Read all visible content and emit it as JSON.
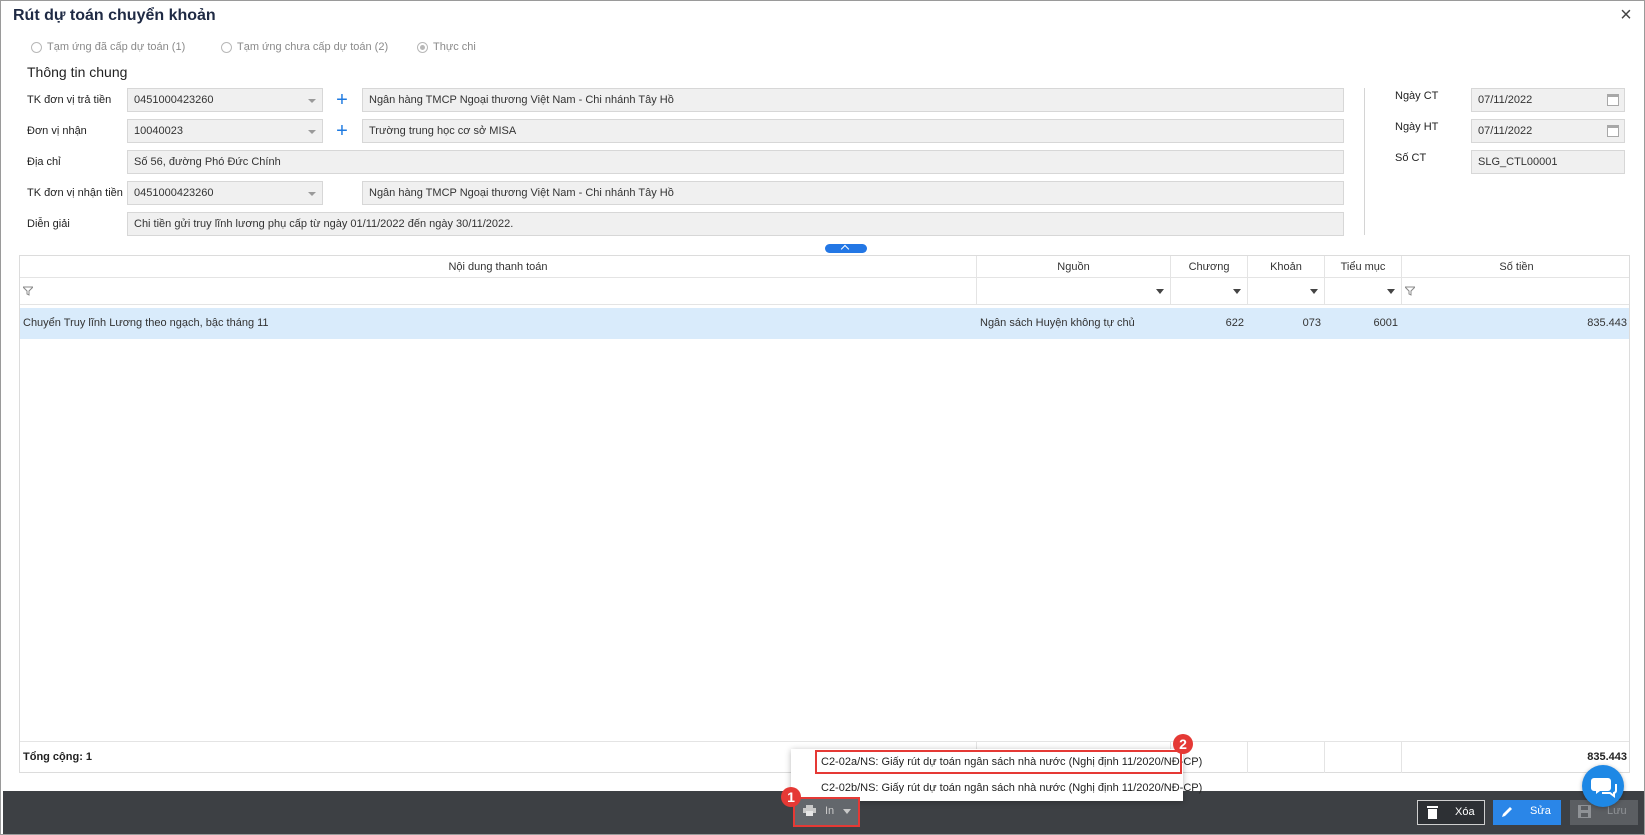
{
  "window": {
    "title": "Rút dự toán chuyển khoản",
    "close_icon": "close-icon"
  },
  "payment_types": [
    {
      "label": "Tạm ứng đã cấp dự toán (1)",
      "selected": false
    },
    {
      "label": "Tạm ứng chưa cấp dự toán (2)",
      "selected": false
    },
    {
      "label": "Thực chi",
      "selected": true
    }
  ],
  "general": {
    "title": "Thông tin chung",
    "payer_account": {
      "label": "TK đơn vị trả tiền",
      "value": "0451000423260",
      "bank": "Ngân hàng TMCP Ngoại thương Việt Nam - Chi nhánh Tây Hồ"
    },
    "receiver": {
      "label": "Đơn vị nhận",
      "value": "10040023",
      "name": "Trường trung học cơ sở MISA"
    },
    "address": {
      "label": "Địa chỉ",
      "value": "Số 56, đường Phó Đức Chính"
    },
    "receiver_account": {
      "label": "TK đơn vị nhận tiền",
      "value": "0451000423260",
      "bank": "Ngân hàng TMCP Ngoại thương Việt Nam - Chi nhánh Tây Hồ"
    },
    "description": {
      "label": "Diễn giải",
      "value": "Chi tiền gửi truy lĩnh lương phụ cấp từ ngày 01/11/2022 đến ngày 30/11/2022."
    }
  },
  "voucher": {
    "date": {
      "label": "Ngày CT",
      "value": "07/11/2022"
    },
    "posting_date": {
      "label": "Ngày HT",
      "value": "07/11/2022"
    },
    "number": {
      "label": "Số CT",
      "value": "SLG_CTL00001"
    }
  },
  "grid": {
    "columns": {
      "content": "Nội dung thanh toán",
      "source": "Nguồn",
      "chapter": "Chương",
      "item": "Khoản",
      "subitem": "Tiểu mục",
      "amount": "Số tiền"
    },
    "rows": [
      {
        "content": "Chuyển Truy lĩnh Lương theo ngạch, bậc tháng 11",
        "source": "Ngân sách Huyện không tự chủ",
        "chapter": "622",
        "item": "073",
        "subitem": "6001",
        "amount": "835.443"
      }
    ],
    "footer": {
      "count_label": "Tổng cộng: 1",
      "total": "835.443"
    }
  },
  "print_menu": {
    "items": [
      "C2-02a/NS: Giấy rút dự toán ngân sách nhà nước (Nghị định 11/2020/NĐ-CP)",
      "C2-02b/NS: Giấy rút dự toán ngân sách nhà nước (Nghị định 11/2020/NĐ-CP)"
    ]
  },
  "callouts": {
    "one": "1",
    "two": "2"
  },
  "toolbar": {
    "print": "In",
    "delete": "Xóa",
    "edit": "Sửa",
    "save": "Lưu"
  },
  "colors": {
    "accent": "#2a86e8",
    "highlight": "#e53935",
    "selected_row": "#d9ebfb",
    "bottom_bar": "#3d4044"
  }
}
